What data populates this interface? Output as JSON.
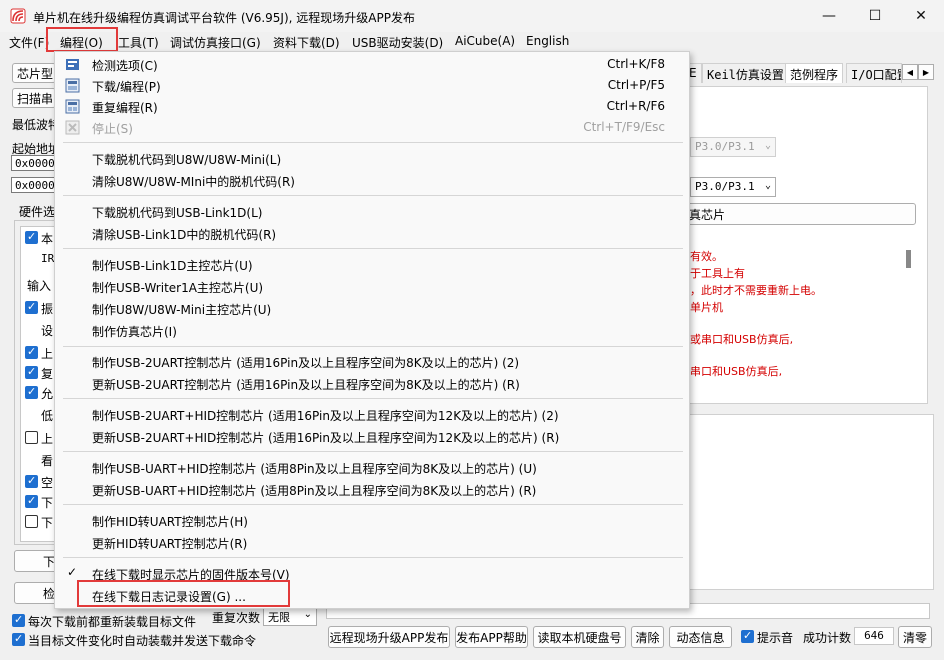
{
  "window": {
    "title": "单片机在线升级编程仿真调试平台软件 (V6.95J), 远程现场升级APP发布",
    "minimize_glyph": "—",
    "maximize_glyph": "☐",
    "close_glyph": "✕"
  },
  "menubar": {
    "items": [
      "文件(F)",
      "编程(O)",
      "工具(T)",
      "调试仿真接口(G)",
      "资料下载(D)",
      "USB驱动安装(D)",
      "AiCube(A)",
      "English"
    ]
  },
  "left_panel": {
    "chip_model_label": "芯片型",
    "scan_button": "扫描串",
    "min_baud_label": "最低波特",
    "start_addr_label": "起始地址",
    "addr_value_1": "0x0000",
    "addr_value_2": "0x0000",
    "hw_options_label": "硬件选",
    "hw_rows": [
      "本",
      "IR",
      "输入",
      "振",
      "设",
      "上",
      "复",
      "允",
      "低",
      "上",
      "看",
      "空",
      "下",
      "下"
    ],
    "download_button": "下",
    "check_button": "检"
  },
  "right_panel": {
    "tabs": [
      "E",
      "Keil仿真设置",
      "范例程序",
      "I/O口配置"
    ],
    "port_select_1": "P3.0/P3.1",
    "port_select_2": "P3.0/P3.1",
    "chip_button_tail": "真芯片",
    "info_lines": [
      "有效。",
      "于工具上有",
      "，此时才不需要重新上电。",
      "单片机",
      "",
      "或串口和USB仿真后,",
      "",
      "串口和USB仿真后,"
    ]
  },
  "bottom": {
    "reload_each_time": "每次下载前都重新装载目标文件",
    "auto_reload_on_change": "当目标文件变化时自动装载并发送下载命令",
    "repeat_count_label": "重复次数",
    "repeat_count_value": "无限",
    "buttons": [
      "远程现场升级APP发布",
      "发布APP帮助",
      "读取本机硬盘号",
      "清除",
      "动态信息"
    ],
    "beep_label": "提示音",
    "success_count_label": "成功计数",
    "success_count_value": "646",
    "clear_button": "清零"
  },
  "dropdown": {
    "items": [
      {
        "label": "检测选项(C)",
        "shortcut": "Ctrl+K/F8",
        "icon": "check-options-icon"
      },
      {
        "label": "下载/编程(P)",
        "shortcut": "Ctrl+P/F5",
        "icon": "download-icon"
      },
      {
        "label": "重复编程(R)",
        "shortcut": "Ctrl+R/F6",
        "icon": "repeat-icon"
      },
      {
        "label": "停止(S)",
        "shortcut": "Ctrl+T/F9/Esc",
        "icon": "stop-icon",
        "disabled": true
      },
      {
        "label": "下载脱机代码到U8W/U8W-Mini(L)"
      },
      {
        "label": "清除U8W/U8W-MIni中的脱机代码(R)"
      },
      {
        "label": "下载脱机代码到USB-Link1D(L)"
      },
      {
        "label": "清除USB-Link1D中的脱机代码(R)"
      },
      {
        "label": "制作USB-Link1D主控芯片(U)"
      },
      {
        "label": "制作USB-Writer1A主控芯片(U)"
      },
      {
        "label": "制作U8W/U8W-Mini主控芯片(U)"
      },
      {
        "label": "制作仿真芯片(I)"
      },
      {
        "label": "制作USB-2UART控制芯片 (适用16Pin及以上且程序空间为8K及以上的芯片) (2)"
      },
      {
        "label": "更新USB-2UART控制芯片 (适用16Pin及以上且程序空间为8K及以上的芯片) (R)"
      },
      {
        "label": "制作USB-2UART+HID控制芯片 (适用16Pin及以上且程序空间为12K及以上的芯片) (2)"
      },
      {
        "label": "更新USB-2UART+HID控制芯片 (适用16Pin及以上且程序空间为12K及以上的芯片) (R)"
      },
      {
        "label": "制作USB-UART+HID控制芯片 (适用8Pin及以上且程序空间为8K及以上的芯片) (U)"
      },
      {
        "label": "更新USB-UART+HID控制芯片 (适用8Pin及以上且程序空间为8K及以上的芯片) (R)"
      },
      {
        "label": "制作HID转UART控制芯片(H)"
      },
      {
        "label": "更新HID转UART控制芯片(R)"
      },
      {
        "label": "在线下载时显示芯片的固件版本号(V)",
        "checked": true
      },
      {
        "label": "在线下载日志记录设置(G) ..."
      }
    ]
  }
}
